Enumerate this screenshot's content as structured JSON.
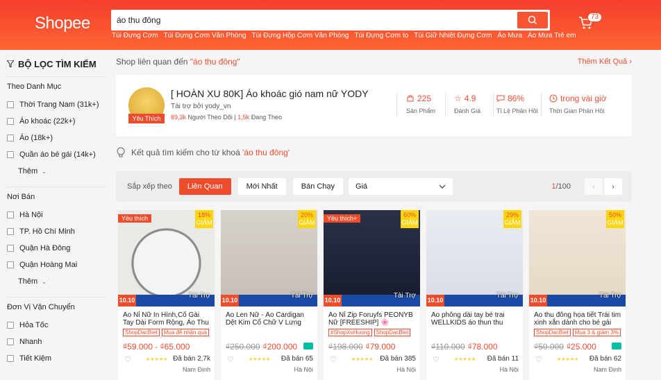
{
  "header": {
    "logo": "Shopee",
    "search_value": "áo thu đông",
    "cart_count": "73",
    "hints": [
      "Túi Đựng Cơm",
      "Túi Đựng Cơm Văn Phòng",
      "Túi Đựng Hộp Cơm Văn Phòng",
      "Túi Đựng Cơm to",
      "Túi Giữ Nhiệt Đựng Cơm",
      "Áo Mưa",
      "Áo Mưa Trẻ em"
    ]
  },
  "sidebar": {
    "title": "BỘ LỌC TÌM KIẾM",
    "groups": [
      {
        "title": "Theo Danh Mục",
        "items": [
          "Thời Trang Nam (31k+)",
          "Áo khoác (22k+)",
          "Áo (18k+)",
          "Quần áo bé gái (14k+)"
        ],
        "more": "Thêm"
      },
      {
        "title": "Nơi Bán",
        "items": [
          "Hà Nội",
          "TP. Hồ Chí Minh",
          "Quận Hà Đông",
          "Quận Hoàng Mai"
        ],
        "more": "Thêm"
      },
      {
        "title": "Đơn Vị Vận Chuyển",
        "items": [
          "Hỏa Tốc",
          "Nhanh",
          "Tiết Kiệm"
        ],
        "more": ""
      }
    ]
  },
  "related": {
    "label": "Shop liên quan đến ",
    "keyword": "\"áo thu đông\"",
    "more_link": "Thêm Kết Quả"
  },
  "shop": {
    "name": "[ HOÀN XU 80K] Áo khoác gió nam nữ YODY",
    "sponsor": "Tài trợ bởi yody_vn",
    "badge": "Yêu Thích",
    "followers": "89,3k",
    "followers_label": " Người Theo Dõi",
    "following": "1,5k",
    "following_label": " Đang Theo",
    "stats": [
      {
        "value": "225",
        "label": "Sản Phẩm",
        "icon": "product-icon"
      },
      {
        "value": "4.9",
        "label": "Đánh Giá",
        "icon": "star-icon"
      },
      {
        "value": "86%",
        "label": "Tỉ Lệ Phản Hồi",
        "icon": "chat-icon"
      },
      {
        "value": "trong vài giờ",
        "label": "Thời Gian Phản Hồi",
        "icon": "clock-icon"
      }
    ]
  },
  "results": {
    "label": "Kết quả tìm kiếm cho từ khoá ",
    "keyword": "'áo thu đông'"
  },
  "sort": {
    "label": "Sắp xếp theo",
    "options": [
      "Liên Quan",
      "Mới Nhất",
      "Bán Chạy"
    ],
    "price_label": "Giá",
    "page_current": "1",
    "page_total": "/100"
  },
  "products": [
    {
      "title": "Áo Nỉ Nữ In Hình,Cổ Gài Tay Dài Form Rộng, Áo Thu Đông...",
      "tags": [
        "ShopDacBiet",
        "Mua để nhận quà"
      ],
      "old_price": "",
      "price": "₫59.000 - ₫65.000",
      "sold": "Đã bán 2,7k",
      "location": "Nam Định",
      "discount": "18%",
      "fav": "Yêu thích",
      "sponsor": "Tài Trợ",
      "ship": false
    },
    {
      "title": "Áo Len Nữ - Áo Cardigan Dệt Kim Cổ Chữ V Lưng Cạo Th...",
      "tags": [],
      "old_price": "₫250.000",
      "price": "₫200.000",
      "sold": "Đã bán 65",
      "location": "Hà Nội",
      "discount": "20%",
      "fav": "",
      "sponsor": "Tài Trợ",
      "ship": true
    },
    {
      "title": "Áo Nỉ Zip Foruyfs PEONYB Nữ [FREESHIP] 🌸 Sweate...",
      "tags": [
        "#ShopXuHuong",
        "ShopDacBiet"
      ],
      "old_price": "₫198.000",
      "price": "₫79.000",
      "sold": "Đã bán 385",
      "location": "Hà Nội",
      "discount": "60%",
      "fav": "Yêu thích+",
      "sponsor": "Tài Trợ",
      "ship": false
    },
    {
      "title": "Áo phông dài tay bé trai WELLKIDS áo thun thu đôn...",
      "tags": [],
      "old_price": "₫110.000",
      "price": "₫78.000",
      "sold": "Đã bán 11",
      "location": "Hà Nội",
      "discount": "29%",
      "fav": "",
      "sponsor": "Tài Trợ",
      "ship": false
    },
    {
      "title": "Áo thu đông họa tiết Trái tim xinh xắn dành cho bé gái 7-...",
      "tags": [
        "ShopDacBiet",
        "Mua 3 & giảm 3%"
      ],
      "old_price": "₫50.000",
      "price": "₫25.000",
      "sold": "Đã bán 62",
      "location": "Nam Định",
      "discount": "50%",
      "fav": "",
      "sponsor": "Tài Trợ",
      "ship": true
    }
  ],
  "promo_label": "10.10",
  "discount_word": "GIẢM",
  "colors": {
    "brand": "#ee4d2d",
    "header_start": "#f53d2d",
    "header_end": "#ff6633"
  }
}
